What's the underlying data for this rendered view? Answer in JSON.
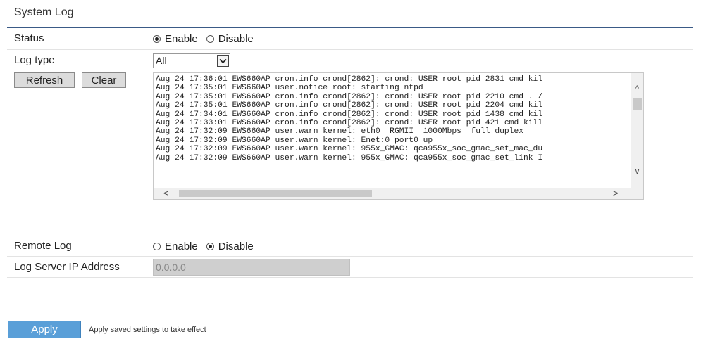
{
  "page": {
    "title": "System Log"
  },
  "status": {
    "label": "Status",
    "options": [
      "Enable",
      "Disable"
    ],
    "selected": "Enable"
  },
  "log_type": {
    "label": "Log type",
    "selected": "All"
  },
  "buttons": {
    "refresh": "Refresh",
    "clear": "Clear"
  },
  "log_lines": [
    "Aug 24 17:36:01 EWS660AP cron.info crond[2862]: crond: USER root pid 2831 cmd kil",
    "Aug 24 17:35:01 EWS660AP user.notice root: starting ntpd",
    "Aug 24 17:35:01 EWS660AP cron.info crond[2862]: crond: USER root pid 2210 cmd . /",
    "Aug 24 17:35:01 EWS660AP cron.info crond[2862]: crond: USER root pid 2204 cmd kil",
    "Aug 24 17:34:01 EWS660AP cron.info crond[2862]: crond: USER root pid 1438 cmd kil",
    "Aug 24 17:33:01 EWS660AP cron.info crond[2862]: crond: USER root pid 421 cmd kill",
    "Aug 24 17:32:09 EWS660AP user.warn kernel: eth0  RGMII  1000Mbps  full duplex",
    "Aug 24 17:32:09 EWS660AP user.warn kernel: Enet:0 port0 up",
    "Aug 24 17:32:09 EWS660AP user.warn kernel: 955x_GMAC: qca955x_soc_gmac_set_mac_du",
    "Aug 24 17:32:09 EWS660AP user.warn kernel: 955x_GMAC: qca955x_soc_gmac_set_link I"
  ],
  "remote_log": {
    "label": "Remote Log",
    "options": [
      "Enable",
      "Disable"
    ],
    "selected": "Disable"
  },
  "log_server": {
    "label": "Log Server IP Address",
    "value": "0.0.0.0"
  },
  "apply": {
    "label": "Apply",
    "note": "Apply saved settings to take effect"
  },
  "colors": {
    "accent": "#5a9fd8",
    "title_rule": "#3a5a86"
  }
}
